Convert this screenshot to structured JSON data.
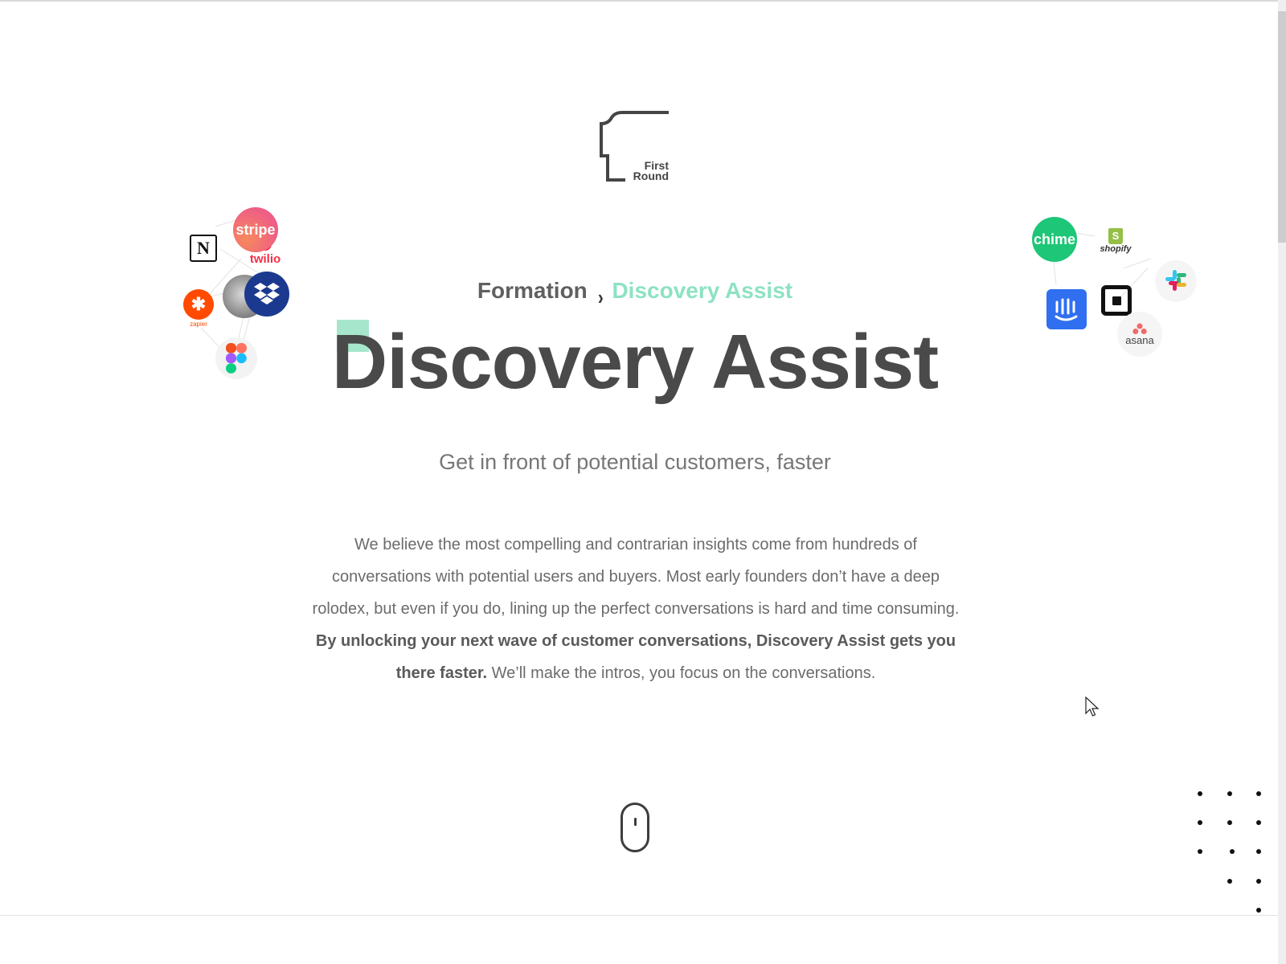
{
  "logo": {
    "line1": "First",
    "line2": "Round",
    "icon": "first-round-logo"
  },
  "breadcrumb": {
    "parent": "Formation",
    "separator": "›",
    "current": "Discovery Assist"
  },
  "hero": {
    "title": "Discovery Assist",
    "subtitle": "Get in front of potential customers, faster"
  },
  "body": {
    "text_1": "We believe the most compelling and contrarian insights come from hundreds of conversations with potential users and buyers. Most early founders don’t have a deep rolodex, but even if you do, lining up the perfect conversations is hard and time consuming. ",
    "text_bold": "By unlocking your next wave of customer conversations, Discovery Assist gets you there faster.",
    "text_2": " We’ll make the intros, you focus on the conversations."
  },
  "left_logos": {
    "stripe": "stripe",
    "notion": "N",
    "twilio": "twilio",
    "zapier": "zapier",
    "dropbox": "dropbox",
    "figma": "figma",
    "person": "founder-photo"
  },
  "right_logos": {
    "chime": "chime",
    "shopify": "shopify",
    "slack": "slack",
    "intercom": "intercom",
    "square": "square",
    "asana": "asana"
  },
  "colors": {
    "accent": "#8de2c2",
    "accent_square": "#a6e6cc",
    "title": "#4a4a4a",
    "text": "#6b6b6b",
    "stripe": "#f26b6b",
    "chime": "#1ec677",
    "intercom": "#2f6ff0",
    "dropbox": "#1b3a8f",
    "zapier": "#ff4a00",
    "twilio": "#f22f46",
    "asana": "#f06a6a"
  },
  "scroll_indicator": "mouse-scroll-icon"
}
